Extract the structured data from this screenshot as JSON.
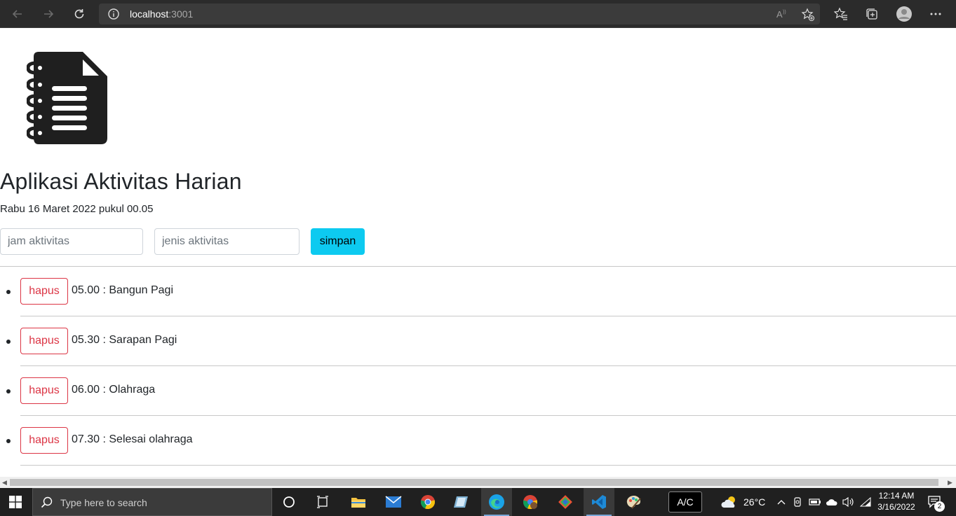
{
  "browser": {
    "url_host": "localhost",
    "url_port": ":3001"
  },
  "app": {
    "title": "Aplikasi Aktivitas Harian",
    "date": "Rabu 16 Maret 2022 pukul 00.05",
    "time_placeholder": "jam aktivitas",
    "activity_placeholder": "jenis aktivitas",
    "save_label": "simpan",
    "delete_label": "hapus",
    "activities": [
      {
        "text": "05.00 : Bangun Pagi"
      },
      {
        "text": "05.30 : Sarapan Pagi"
      },
      {
        "text": "06.00 : Olahraga"
      },
      {
        "text": "07.30 : Selesai olahraga"
      }
    ]
  },
  "taskbar": {
    "search_placeholder": "Type here to search",
    "ac_label": "A/C",
    "weather": "26°C",
    "time": "12:14 AM",
    "date": "3/16/2022",
    "notification_count": "2"
  },
  "colors": {
    "info": "#0dcaf0",
    "danger": "#dc3545",
    "text": "#212529"
  }
}
